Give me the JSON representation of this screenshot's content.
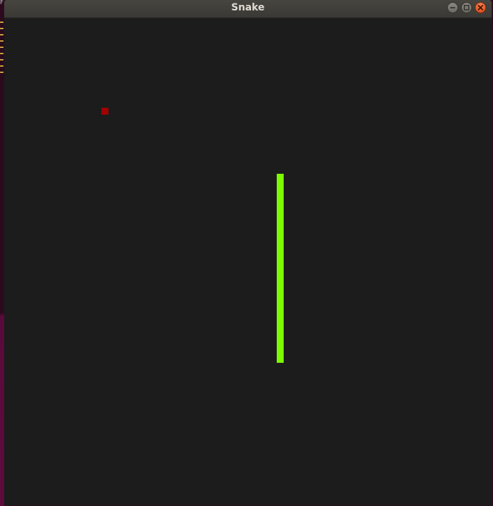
{
  "window": {
    "title": "Snake",
    "buttons": {
      "minimize": "minimize-icon",
      "maximize": "maximize-icon",
      "close": "close-icon"
    }
  },
  "game": {
    "food_color": "#a00000",
    "snake_color": "#7cfc00",
    "background_color": "#1c1c1c",
    "snake_direction": "vertical"
  }
}
